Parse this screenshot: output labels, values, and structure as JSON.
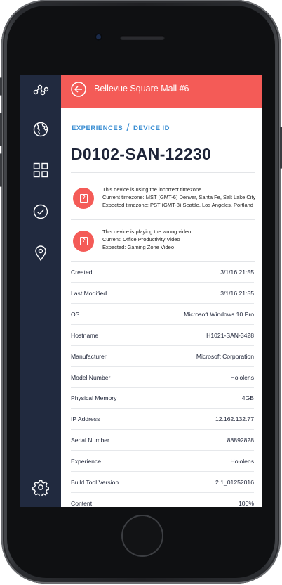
{
  "header": {
    "title": "Bellevue Square Mall #6"
  },
  "breadcrumb": {
    "first": "EXPERIENCES",
    "separator": "/",
    "second": "DEVICE ID"
  },
  "device": {
    "id": "D0102-SAN-12230"
  },
  "alerts": [
    {
      "icon": "alert-icon",
      "line1": "This device is using the incorrect timezone.",
      "line2": "Current timezone: MST (GMT-6) Denver, Santa Fe, Salt Lake City",
      "line3": "Expected timezone: PST (GMT-8) Seattle, Los Angeles, Portland"
    },
    {
      "icon": "alert-icon",
      "line1": "This device is playing the wrong video.",
      "line2": "Current: Office Productivity  Video",
      "line3": "Expected: Gaming Zone Video"
    }
  ],
  "details": [
    {
      "label": "Created",
      "value": "3/1/16 21:55"
    },
    {
      "label": "Last Modified",
      "value": "3/1/16 21:55"
    },
    {
      "label": "OS",
      "value": "Microsoft Windows 10 Pro"
    },
    {
      "label": "Hostname",
      "value": "H1021-SAN-3428"
    },
    {
      "label": "Manufacturer",
      "value": "Microsoft Corporation"
    },
    {
      "label": "Model Number",
      "value": "Hololens"
    },
    {
      "label": "Physical Memory",
      "value": "4GB"
    },
    {
      "label": "IP Address",
      "value": "12.162.132.77"
    },
    {
      "label": "Serial Number",
      "value": "88892828"
    },
    {
      "label": "Experience",
      "value": "Hololens"
    },
    {
      "label": "Build Tool Version",
      "value": "2.1_01252016"
    },
    {
      "label": "Content",
      "value": "100%"
    }
  ],
  "sidebar": {
    "icons": [
      "network-icon",
      "globe-icon",
      "grid-icon",
      "check-circle-icon",
      "location-pin-icon",
      "settings-gear-icon"
    ]
  },
  "colors": {
    "accent": "#f45b57",
    "sidebar": "#212a3f",
    "link": "#3c8fd3"
  }
}
